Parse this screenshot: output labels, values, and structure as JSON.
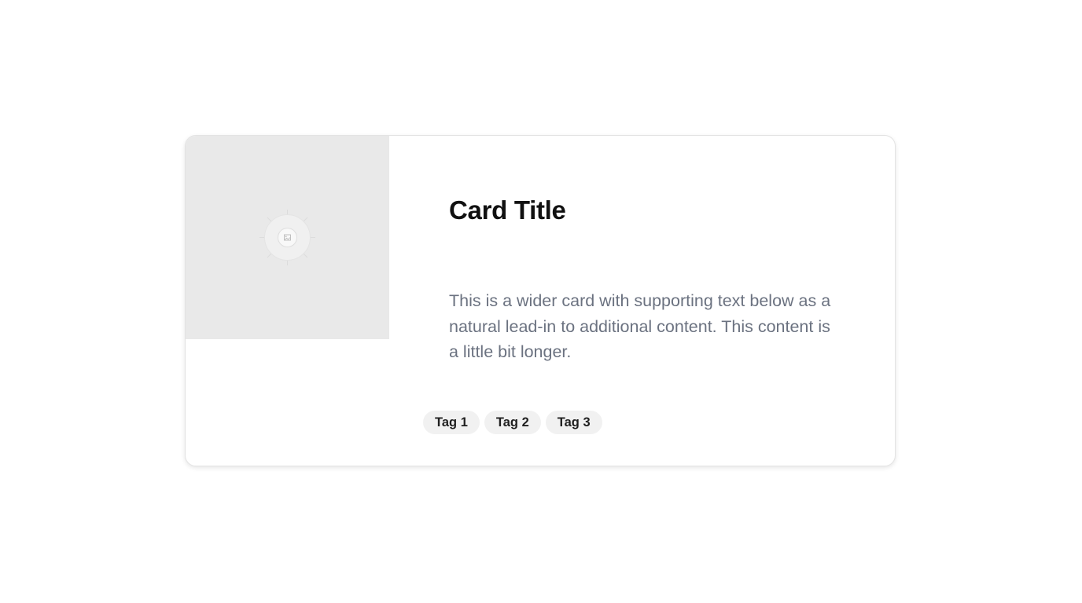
{
  "card": {
    "image": {
      "icon": "image-placeholder-icon",
      "background": "#e9e9e9"
    },
    "title": "Card Title",
    "body": "This is a wider card with supporting text below as a natural lead-in to additional content. This content is a little bit longer.",
    "tags": [
      {
        "label": "Tag 1"
      },
      {
        "label": "Tag 2"
      },
      {
        "label": "Tag 3"
      }
    ]
  },
  "colors": {
    "title": "#111111",
    "body_text": "#6b7280",
    "tag_background": "#f1f1f1",
    "card_border": "#e3e3e3"
  }
}
